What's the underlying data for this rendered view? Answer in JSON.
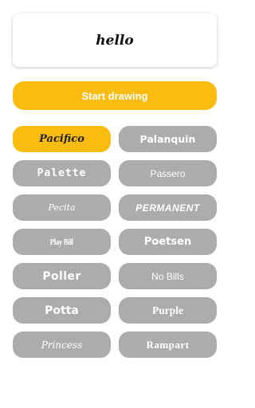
{
  "preview": {
    "text": "hello"
  },
  "start_button": {
    "label": "Start drawing"
  },
  "colors": {
    "accent": "#fbbc12",
    "button_gray": "#acacac",
    "background": "#ffffff"
  },
  "selected_font": "Pacifico",
  "fonts": [
    {
      "label": "Pacifico"
    },
    {
      "label": "Palanquin"
    },
    {
      "label": "Palette"
    },
    {
      "label": "Passero"
    },
    {
      "label": "Pecita"
    },
    {
      "label": "Permanent"
    },
    {
      "label": "Play Bill"
    },
    {
      "label": "Poetsen"
    },
    {
      "label": "Poller"
    },
    {
      "label": "No Bills"
    },
    {
      "label": "Potta"
    },
    {
      "label": "Purple"
    },
    {
      "label": "Princess"
    },
    {
      "label": "Rampart"
    }
  ]
}
